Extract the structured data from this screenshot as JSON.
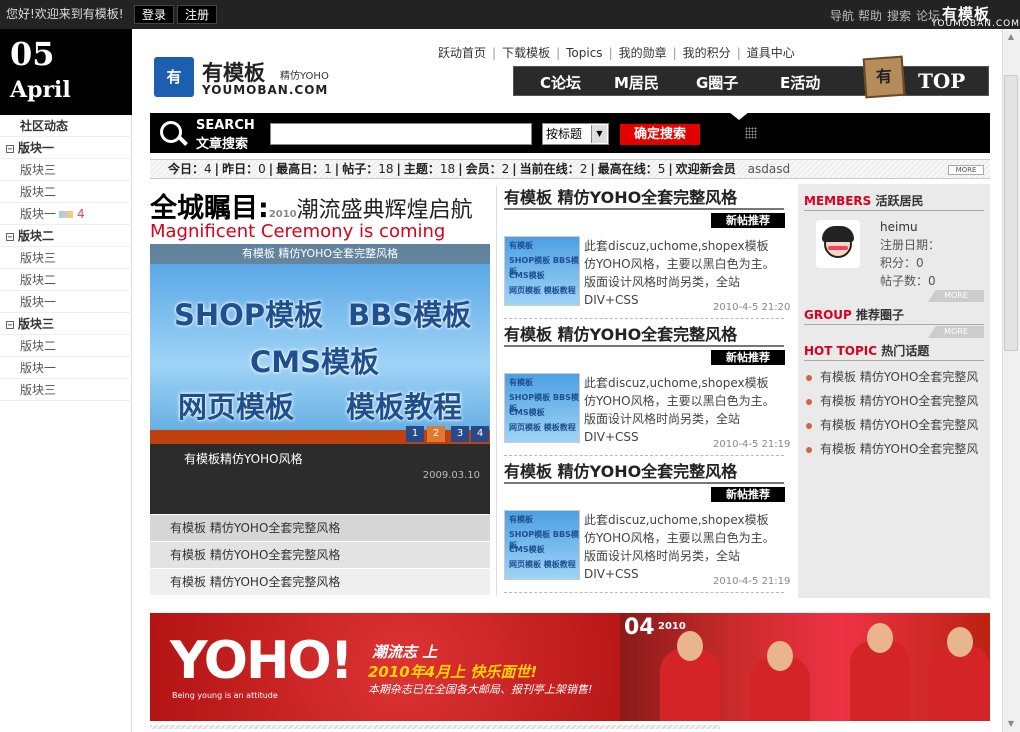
{
  "topbar": {
    "welcome": "您好!欢迎来到有模板!",
    "login": "登录",
    "register": "注册",
    "links": [
      "导航",
      "帮助",
      "搜索",
      "论坛"
    ],
    "logo_cn": "有模板",
    "logo_en": "YOUMOBAN.COM"
  },
  "sidebar": {
    "day": "05",
    "month": "April",
    "items": [
      {
        "label": "社区动态",
        "type": "cat"
      },
      {
        "label": "版块一",
        "type": "group"
      },
      {
        "label": "版块三",
        "type": "sub"
      },
      {
        "label": "版块二",
        "type": "sub"
      },
      {
        "label": "版块一",
        "type": "sub",
        "badge": "4"
      },
      {
        "label": "版块二",
        "type": "group"
      },
      {
        "label": "版块三",
        "type": "sub"
      },
      {
        "label": "版块二",
        "type": "sub"
      },
      {
        "label": "版块一",
        "type": "sub"
      },
      {
        "label": "版块三",
        "type": "group"
      },
      {
        "label": "版块二",
        "type": "sub"
      },
      {
        "label": "版块一",
        "type": "sub"
      },
      {
        "label": "版块三",
        "type": "sub"
      }
    ]
  },
  "header": {
    "logo_cn": "有模板",
    "logo_yoho": "精仿YOHO",
    "logo_en": "YOUMOBAN.COM",
    "logo_mark": "有",
    "topnav": [
      "跃动首页",
      "下载模板",
      "Topics",
      "我的勋章",
      "我的积分",
      "道具中心"
    ],
    "bignav": [
      "C论坛",
      "M居民",
      "G圈子",
      "E活动"
    ],
    "top_cube": "有",
    "top_label": "TOP"
  },
  "search": {
    "label_en": "SEARCH",
    "label_cn": "文章搜索",
    "value": "",
    "select_value": "按标题",
    "button": "确定搜索"
  },
  "stats": {
    "text": [
      {
        "k": "今日",
        "v": "4"
      },
      {
        "k": "昨日",
        "v": "0"
      },
      {
        "k": "最高日",
        "v": "1"
      },
      {
        "k": "帖子",
        "v": "18"
      },
      {
        "k": "主题",
        "v": "18"
      },
      {
        "k": "会员",
        "v": "2"
      },
      {
        "k": "当前在线",
        "v": "2"
      },
      {
        "k": "最高在线",
        "v": "5"
      }
    ],
    "welcome_label": "欢迎新会员",
    "newest_member": "asdasd",
    "more": "MORE"
  },
  "feature": {
    "headline_big": "全城瞩目:",
    "headline_year": "2010",
    "headline_rest": "潮流盛典辉煌启航",
    "headline_en": "Magnificent Ceremony is coming",
    "slide_caption": "有模板 精仿YOHO全套完整风格",
    "slide_lines": [
      "SHOP模板",
      "BBS模板",
      "CMS模板",
      "网页模板",
      "模板教程"
    ],
    "pages": [
      "1",
      "2",
      "3",
      "4"
    ],
    "info_title": "有模板精仿YOHO风格",
    "info_date": "2009.03.10",
    "list": [
      "有模板 精仿YOHO全套完整风格",
      "有模板 精仿YOHO全套完整风格",
      "有模板 精仿YOHO全套完整风格"
    ]
  },
  "articles": [
    {
      "title": "有模板 精仿YOHO全套完整风格",
      "badge": "新帖推荐",
      "thumb": [
        "有模板",
        "SHOP模板 BBS模板",
        "CMS模板",
        "网页模板 模板教程"
      ],
      "text": "此套discuz,uchome,shopex模板仿YOHO风格，主要以黑白色为主。版面设计风格时尚另类，全站DIV+CSS",
      "date": "2010-4-5 21:20"
    },
    {
      "title": "有模板 精仿YOHO全套完整风格",
      "badge": "新帖推荐",
      "thumb": [
        "有模板",
        "SHOP模板 BBS模板",
        "CMS模板",
        "网页模板 模板教程"
      ],
      "text": "此套discuz,uchome,shopex模板仿YOHO风格，主要以黑白色为主。版面设计风格时尚另类，全站DIV+CSS",
      "date": "2010-4-5 21:19"
    },
    {
      "title": "有模板 精仿YOHO全套完整风格",
      "badge": "新帖推荐",
      "thumb": [
        "有模板",
        "SHOP模板 BBS模板",
        "CMS模板",
        "网页模板 模板教程"
      ],
      "text": "此套discuz,uchome,shopex模板仿YOHO风格，主要以黑白色为主。版面设计风格时尚另类，全站DIV+CSS",
      "date": "2010-4-5 21:19"
    }
  ],
  "members": {
    "head_en": "MEMBERS",
    "head_cn": "活跃居民",
    "name": "heimu",
    "reg_label": "注册日期：",
    "points_label": "积分：",
    "points": "0",
    "posts_label": "帖子数：",
    "posts": "0",
    "more": "MORE"
  },
  "group": {
    "head_en": "GROUP",
    "head_cn": "推荐圈子",
    "more": "MORE"
  },
  "hot": {
    "head_en": "HOT TOPIC",
    "head_cn": "热门话题",
    "items": [
      "有模板 精仿YOHO全套完整风",
      "有模板 精仿YOHO全套完整风",
      "有模板 精仿YOHO全套完整风",
      "有模板 精仿YOHO全套完整风"
    ]
  },
  "banner": {
    "logo": "YOHO!",
    "tagline": "Being young is an attitude",
    "line1": "潮流志 上",
    "line2": "2010年4月上 快乐面世!",
    "line3": "本期杂志已在全国各大邮局、报刊亭上架销售!",
    "issue": "04",
    "year": "2010"
  }
}
